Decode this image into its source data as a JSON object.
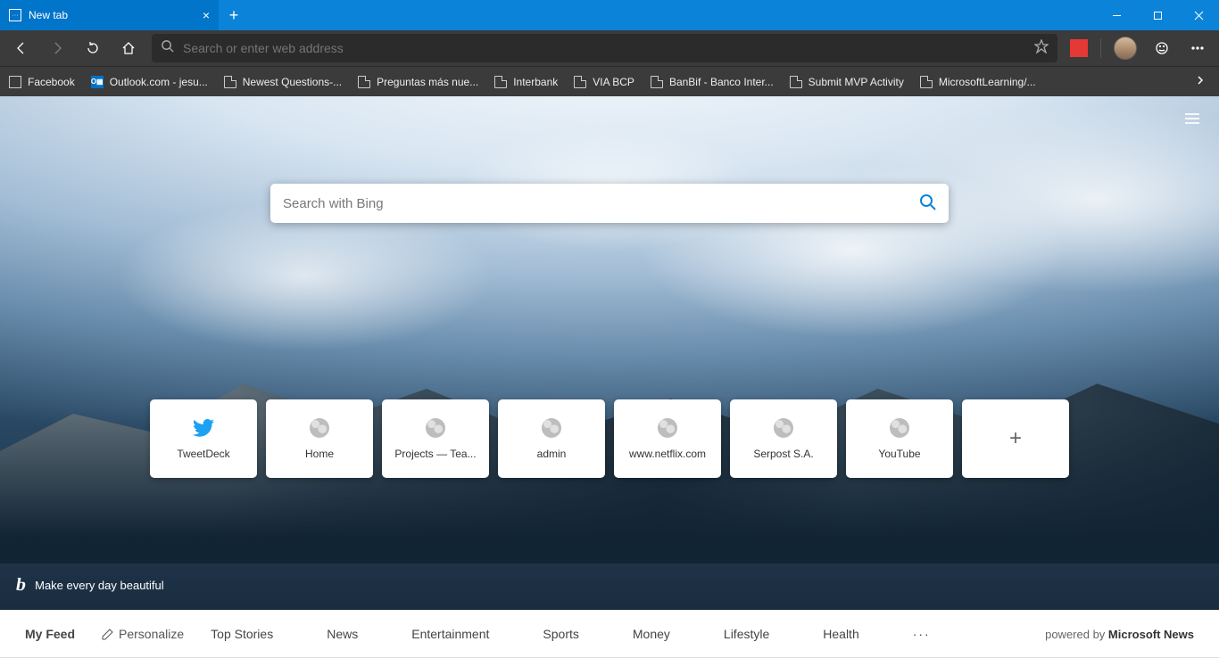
{
  "tab": {
    "title": "New tab"
  },
  "omnibox": {
    "placeholder": "Search or enter web address"
  },
  "favorites": [
    {
      "label": "Facebook",
      "icon": "fb"
    },
    {
      "label": "Outlook.com - jesu...",
      "icon": "ol"
    },
    {
      "label": "Newest Questions-...",
      "icon": "pg"
    },
    {
      "label": "Preguntas más nue...",
      "icon": "pg"
    },
    {
      "label": "Interbank",
      "icon": "pg"
    },
    {
      "label": "VIA BCP",
      "icon": "pg"
    },
    {
      "label": "BanBif - Banco Inter...",
      "icon": "pg"
    },
    {
      "label": "Submit MVP Activity",
      "icon": "pg"
    },
    {
      "label": "MicrosoftLearning/...",
      "icon": "pg"
    }
  ],
  "ntp": {
    "search_placeholder": "Search with Bing",
    "caption": "Make every day beautiful"
  },
  "tiles": [
    {
      "label": "TweetDeck",
      "icon": "twitter"
    },
    {
      "label": "Home",
      "icon": "globe"
    },
    {
      "label": "Projects — Tea...",
      "icon": "globe"
    },
    {
      "label": "admin",
      "icon": "globe"
    },
    {
      "label": "www.netflix.com",
      "icon": "globe"
    },
    {
      "label": "Serpost S.A.",
      "icon": "globe"
    },
    {
      "label": "YouTube",
      "icon": "globe"
    }
  ],
  "feed": {
    "lead": "My Feed",
    "personalize": "Personalize",
    "cats": [
      "Top Stories",
      "News",
      "Entertainment",
      "Sports",
      "Money",
      "Lifestyle",
      "Health"
    ],
    "powered_prefix": "powered by ",
    "powered_brand": "Microsoft News"
  }
}
